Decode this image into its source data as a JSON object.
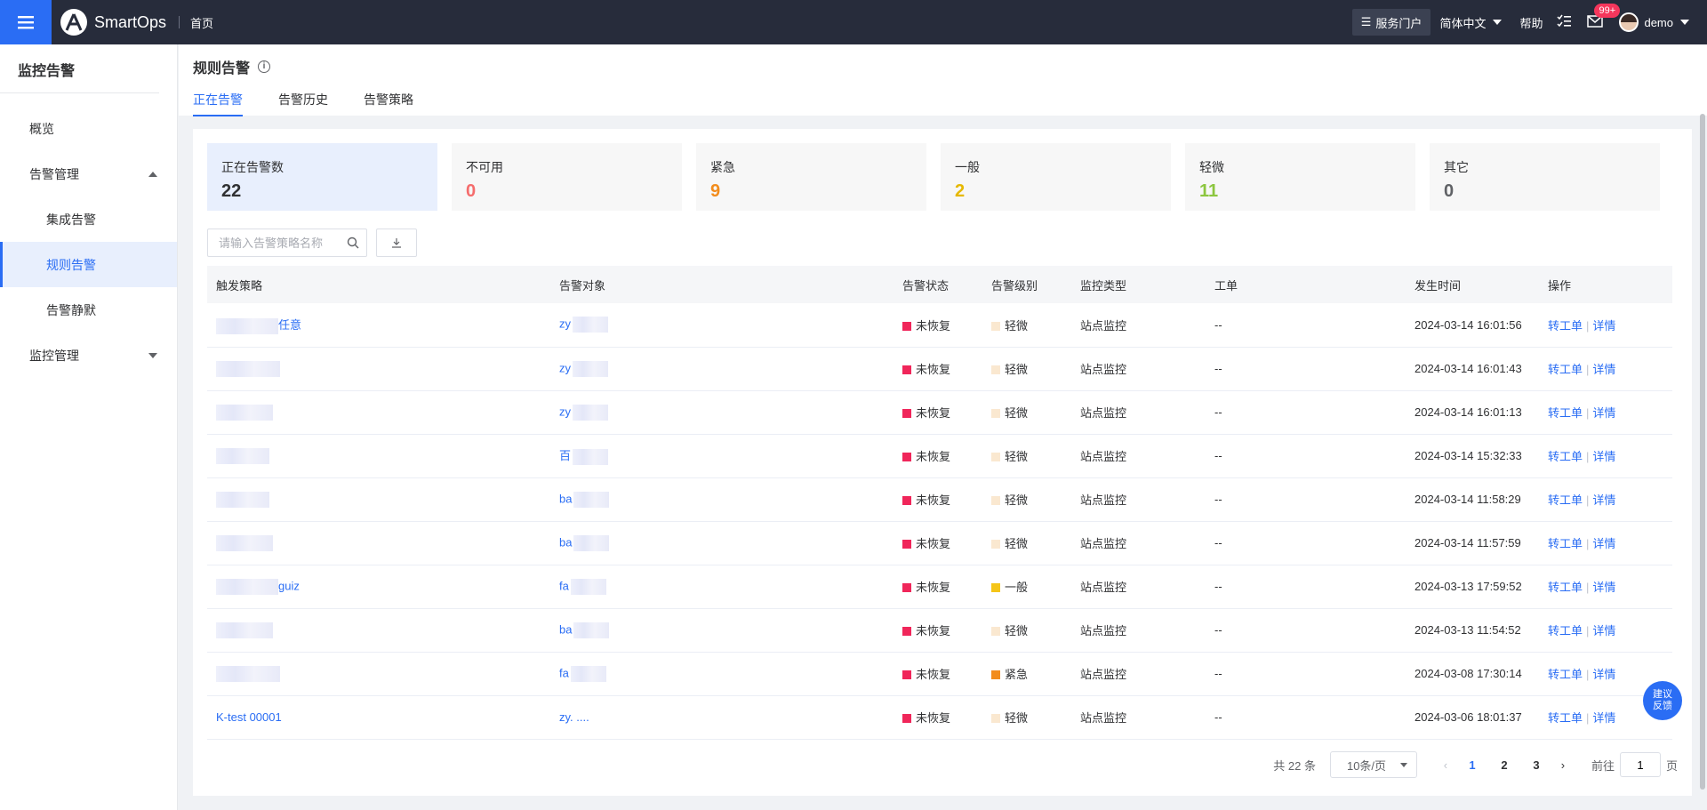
{
  "app": {
    "name": "SmartOps",
    "breadcrumb": "首页"
  },
  "topbar": {
    "portal": "服务门户",
    "language": "简体中文",
    "help": "帮助",
    "mail_badge": "99+",
    "user": "demo"
  },
  "sidebar": {
    "title": "监控告警",
    "items": [
      {
        "label": "概览"
      },
      {
        "label": "告警管理"
      },
      {
        "label": "集成告警"
      },
      {
        "label": "规则告警"
      },
      {
        "label": "告警静默"
      },
      {
        "label": "监控管理"
      }
    ]
  },
  "page": {
    "title": "规则告警",
    "tabs": [
      {
        "label": "正在告警"
      },
      {
        "label": "告警历史"
      },
      {
        "label": "告警策略"
      }
    ]
  },
  "stats": [
    {
      "label": "正在告警数",
      "value": "22",
      "color": "#303133"
    },
    {
      "label": "不可用",
      "value": "0",
      "color": "#f56c6c"
    },
    {
      "label": "紧急",
      "value": "9",
      "color": "#f28c1c"
    },
    {
      "label": "一般",
      "value": "2",
      "color": "#e6b800"
    },
    {
      "label": "轻微",
      "value": "11",
      "color": "#8cc63f"
    },
    {
      "label": "其它",
      "value": "0",
      "color": "#606266"
    }
  ],
  "search": {
    "placeholder": "请输入告警策略名称"
  },
  "table": {
    "headers": [
      "触发策略",
      "告警对象",
      "告警状态",
      "告警级别",
      "监控类型",
      "工单",
      "发生时间",
      "操作"
    ],
    "rows": [
      {
        "policy": "任意",
        "target": "zy",
        "status": "未恢复",
        "level": "轻微",
        "level_color": "#fae8d0",
        "type": "站点监控",
        "ticket": "--",
        "time": "2024-03-14 16:01:56",
        "op1": "转工单",
        "op2": "详情"
      },
      {
        "policy": "",
        "target": "zy",
        "status": "未恢复",
        "level": "轻微",
        "level_color": "#fae8d0",
        "type": "站点监控",
        "ticket": "--",
        "time": "2024-03-14 16:01:43",
        "op1": "转工单",
        "op2": "详情"
      },
      {
        "policy": "",
        "target": "zy",
        "status": "未恢复",
        "level": "轻微",
        "level_color": "#fae8d0",
        "type": "站点监控",
        "ticket": "--",
        "time": "2024-03-14 16:01:13",
        "op1": "转工单",
        "op2": "详情"
      },
      {
        "policy": "",
        "target": "百",
        "status": "未恢复",
        "level": "轻微",
        "level_color": "#fae8d0",
        "type": "站点监控",
        "ticket": "--",
        "time": "2024-03-14 15:32:33",
        "op1": "转工单",
        "op2": "详情"
      },
      {
        "policy": "",
        "target": "ba",
        "status": "未恢复",
        "level": "轻微",
        "level_color": "#fae8d0",
        "type": "站点监控",
        "ticket": "--",
        "time": "2024-03-14 11:58:29",
        "op1": "转工单",
        "op2": "详情"
      },
      {
        "policy": "",
        "target": "ba",
        "status": "未恢复",
        "level": "轻微",
        "level_color": "#fae8d0",
        "type": "站点监控",
        "ticket": "--",
        "time": "2024-03-14 11:57:59",
        "op1": "转工单",
        "op2": "详情"
      },
      {
        "policy": "guiz",
        "target": "fa",
        "status": "未恢复",
        "level": "一般",
        "level_color": "#f5c518",
        "type": "站点监控",
        "ticket": "--",
        "time": "2024-03-13 17:59:52",
        "op1": "转工单",
        "op2": "详情"
      },
      {
        "policy": "",
        "target": "ba",
        "status": "未恢复",
        "level": "轻微",
        "level_color": "#fae8d0",
        "type": "站点监控",
        "ticket": "--",
        "time": "2024-03-13 11:54:52",
        "op1": "转工单",
        "op2": "详情"
      },
      {
        "policy": "",
        "target": "fa",
        "status": "未恢复",
        "level": "紧急",
        "level_color": "#f28c1c",
        "type": "站点监控",
        "ticket": "--",
        "time": "2024-03-08 17:30:14",
        "op1": "转工单",
        "op2": "详情"
      },
      {
        "policy": "K-test 00001",
        "target": "zy. ....",
        "status": "未恢复",
        "level": "轻微",
        "level_color": "#fae8d0",
        "type": "站点监控",
        "ticket": "--",
        "time": "2024-03-06 18:01:37",
        "op1": "转工单",
        "op2": "详情"
      }
    ],
    "status_color": "#f0265a"
  },
  "pagination": {
    "total": "共 22 条",
    "page_size": "10条/页",
    "pages": [
      "1",
      "2",
      "3"
    ],
    "goto_label": "前往",
    "goto_value": "1",
    "page_suffix": "页"
  },
  "feedback": {
    "line1": "建议",
    "line2": "反馈"
  }
}
